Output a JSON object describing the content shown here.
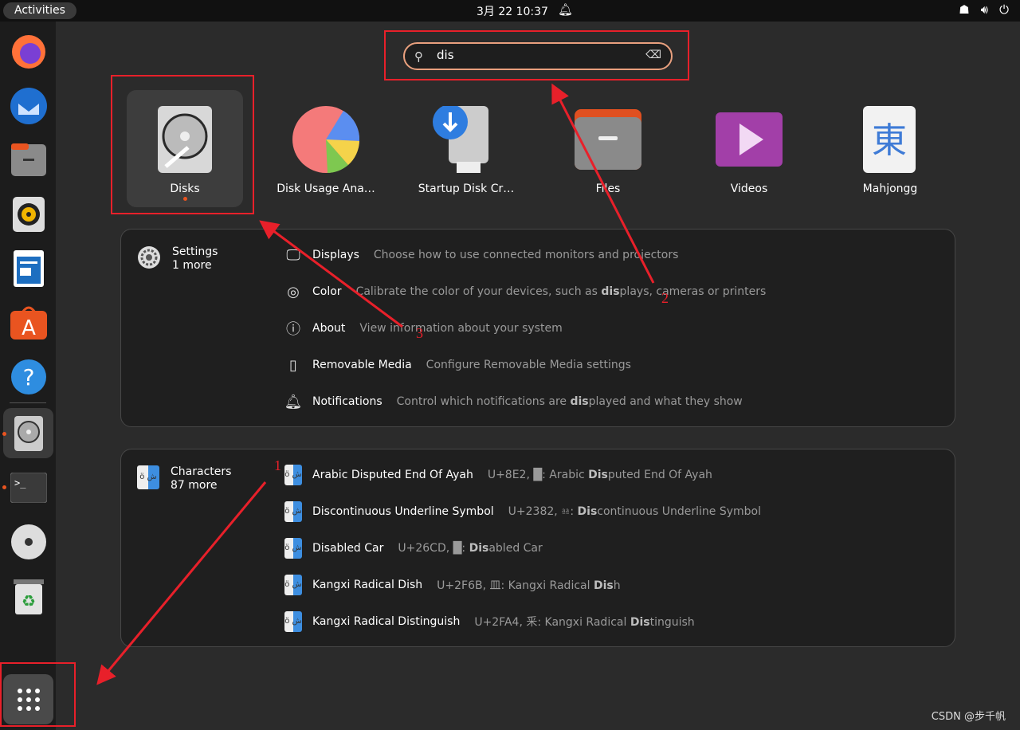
{
  "topbar": {
    "activities": "Activities",
    "clock": "3月 22  10:37",
    "icons": [
      "network-icon",
      "volume-icon",
      "power-icon"
    ]
  },
  "dock": [
    "firefox",
    "thunderbird",
    "files",
    "rhythmbox",
    "libreoffice-writer",
    "app-center",
    "help",
    "disks",
    "terminal",
    "optical-drive",
    "trash",
    "show-apps"
  ],
  "search": {
    "value": "dis"
  },
  "apps": [
    {
      "label": "Disks"
    },
    {
      "label": "Disk Usage Ana…"
    },
    {
      "label": "Startup Disk Cr…"
    },
    {
      "label": "Files"
    },
    {
      "label": "Videos"
    },
    {
      "label": "Mahjongg"
    }
  ],
  "settings": {
    "provider": "Settings",
    "more": "1 more",
    "rows": [
      {
        "name": "Displays",
        "pre": "Choose how to use connected monitors and projectors",
        "bold": "",
        "post": ""
      },
      {
        "name": "Color",
        "pre": "Calibrate the color of your devices, such as ",
        "bold": "dis",
        "post": "plays, cameras or printers"
      },
      {
        "name": "About",
        "pre": "View information about your system",
        "bold": "",
        "post": ""
      },
      {
        "name": "Removable Media",
        "pre": "Configure Removable Media settings",
        "bold": "",
        "post": ""
      },
      {
        "name": "Notifications",
        "pre": "Control which notifications are ",
        "bold": "dis",
        "post": "played and what they show"
      }
    ]
  },
  "characters": {
    "provider": "Characters",
    "more": "87 more",
    "rows": [
      {
        "name": "Arabic Disputed End Of Ayah",
        "pre": "U+8E2, █: Arabic ",
        "bold": "Dis",
        "post": "puted End Of Ayah"
      },
      {
        "name": "Discontinuous Underline Symbol",
        "pre": "U+2382, ⎂: ",
        "bold": "Dis",
        "post": "continuous Underline Symbol"
      },
      {
        "name": "Disabled Car",
        "pre": "U+26CD, █: ",
        "bold": "Dis",
        "post": "abled Car"
      },
      {
        "name": "Kangxi Radical Dish",
        "pre": "U+2F6B, 皿: Kangxi Radical ",
        "bold": "Dis",
        "post": "h"
      },
      {
        "name": "Kangxi Radical Distinguish",
        "pre": "U+2FA4, 釆: Kangxi Radical ",
        "bold": "Dis",
        "post": "tinguish"
      }
    ]
  },
  "annotations": {
    "color": "#e8202a",
    "labels": [
      "1",
      "2",
      "3"
    ]
  },
  "watermark": "CSDN @步千帆"
}
